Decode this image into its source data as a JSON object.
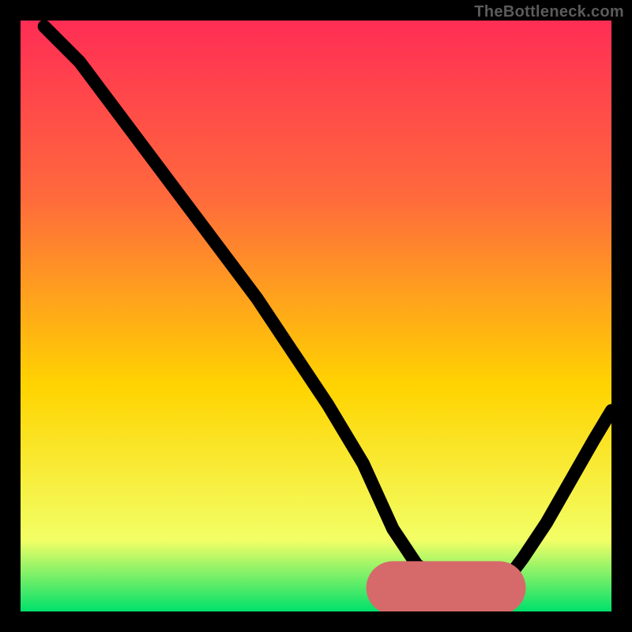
{
  "watermark": "TheBottleneck.com",
  "chart_data": {
    "type": "line",
    "title": "",
    "xlabel": "",
    "ylabel": "",
    "xlim": [
      0,
      100
    ],
    "ylim": [
      0,
      100
    ],
    "grid": false,
    "legend": false,
    "background_gradient": {
      "top_color": "#ff2d55",
      "mid_color": "#ffd400",
      "bottom_color": "#00e06a"
    },
    "highlight_band": {
      "color": "#d66a6a",
      "x_start": 63,
      "x_end": 81,
      "y": 4
    },
    "series": [
      {
        "name": "bottleneck-curve",
        "color": "#000000",
        "x": [
          4,
          10,
          16,
          22,
          28,
          34,
          40,
          46,
          52,
          58,
          63,
          67,
          71,
          75,
          79,
          82,
          85,
          89,
          93,
          97,
          100
        ],
        "y": [
          99,
          93,
          85,
          77,
          69,
          61,
          53,
          44,
          35,
          25,
          14,
          8,
          5,
          4,
          4,
          5,
          9,
          15,
          22,
          29,
          34
        ]
      }
    ]
  }
}
